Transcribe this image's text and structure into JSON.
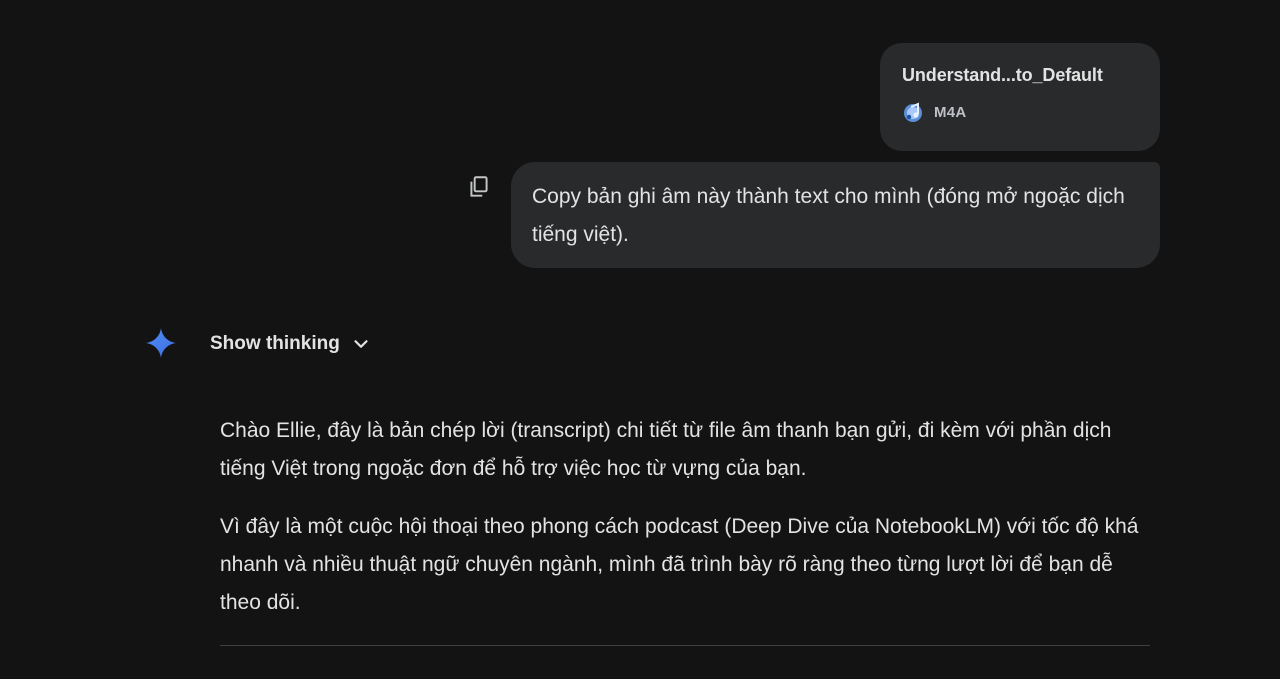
{
  "attachment": {
    "name": "Understand...to_Default",
    "type": "M4A",
    "icon": "audio-file-icon"
  },
  "user_message": {
    "text": "Copy bản ghi âm này thành text cho mình (đóng mở ngoặc dịch tiếng việt).",
    "copy_icon": "copy-icon"
  },
  "model": {
    "avatar_icon": "gemini-sparkle-icon",
    "show_thinking_label": "Show thinking",
    "chevron_icon": "chevron-down-icon",
    "paragraphs": [
      "Chào Ellie, đây là bản chép lời (transcript) chi tiết từ file âm thanh bạn gửi, đi kèm với phần dịch tiếng Việt trong ngoặc đơn để hỗ trợ việc học từ vựng của bạn.",
      "Vì đây là một cuộc hội thoại theo phong cách podcast (Deep Dive của NotebookLM) với tốc độ khá nhanh và nhiều thuật ngữ chuyên ngành, mình đã trình bày rõ ràng theo từng lượt lời để bạn dễ theo dõi."
    ]
  },
  "colors": {
    "background": "#131314",
    "bubble": "#282a2c",
    "text": "#e3e3e3",
    "gemini_blue": "#4285f4"
  }
}
